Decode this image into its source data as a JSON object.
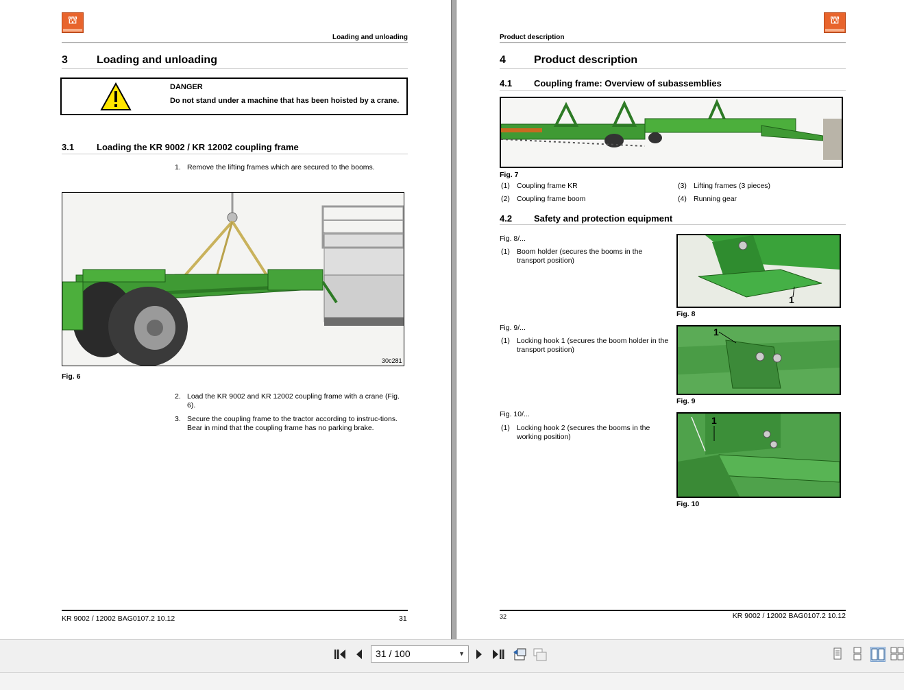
{
  "viewer": {
    "page_indicator": "31 / 100",
    "nav": {
      "first_icon": "skip-to-first-icon",
      "prev_icon": "previous-page-icon",
      "next_icon": "next-page-icon",
      "last_icon": "skip-to-last-icon"
    }
  },
  "left_page": {
    "running_head": "Loading and unloading",
    "section_number": "3",
    "section_title": "Loading and unloading",
    "danger": {
      "label": "DANGER",
      "text": "Do not stand under a machine that has been hoisted by a crane."
    },
    "subsection_number": "3.1",
    "subsection_title": "Loading the KR 9002 / KR 12002 coupling frame",
    "steps": [
      {
        "num": "1.",
        "text": "Remove the lifting frames which are secured to the booms."
      },
      {
        "num": "2.",
        "text": "Load the KR 9002 and KR 12002 coupling frame with a crane (Fig. 6)."
      },
      {
        "num": "3.",
        "text": "Secure the coupling frame to the tractor according to instruc-tions. Bear in mind that the coupling frame has no parking brake."
      }
    ],
    "photo_code": "30c281",
    "figure_caption": "Fig. 6",
    "footer_left": "KR 9002 / 12002  BAG0107.2  10.12",
    "footer_page": "31"
  },
  "right_page": {
    "running_head": "Product description",
    "section_number": "4",
    "section_title": "Product description",
    "sub1_number": "4.1",
    "sub1_title": "Coupling frame: Overview of subassemblies",
    "fig7_caption": "Fig. 7",
    "fig7_items": [
      {
        "num": "(1)",
        "text": "Coupling frame KR"
      },
      {
        "num": "(2)",
        "text": "Coupling frame boom"
      },
      {
        "num": "(3)",
        "text": "Lifting frames (3 pieces)"
      },
      {
        "num": "(4)",
        "text": "Running gear"
      }
    ],
    "sub2_number": "4.2",
    "sub2_title": "Safety and protection equipment",
    "fig8": {
      "ref": "Fig. 8/...",
      "num": "(1)",
      "text": "Boom holder (secures the booms in the transport position)",
      "caption": "Fig. 8",
      "callout": "1"
    },
    "fig9": {
      "ref": "Fig. 9/...",
      "num": "(1)",
      "text": "Locking hook 1 (secures the boom holder in the transport position)",
      "caption": "Fig. 9",
      "callout": "1"
    },
    "fig10": {
      "ref": "Fig. 10/...",
      "num": "(1)",
      "text": "Locking hook 2 (secures the booms in the working position)",
      "caption": "Fig. 10",
      "callout": "1"
    },
    "footer_page": "32",
    "footer_right": "KR 9002 / 12002  BAG0107.2  10.12"
  }
}
